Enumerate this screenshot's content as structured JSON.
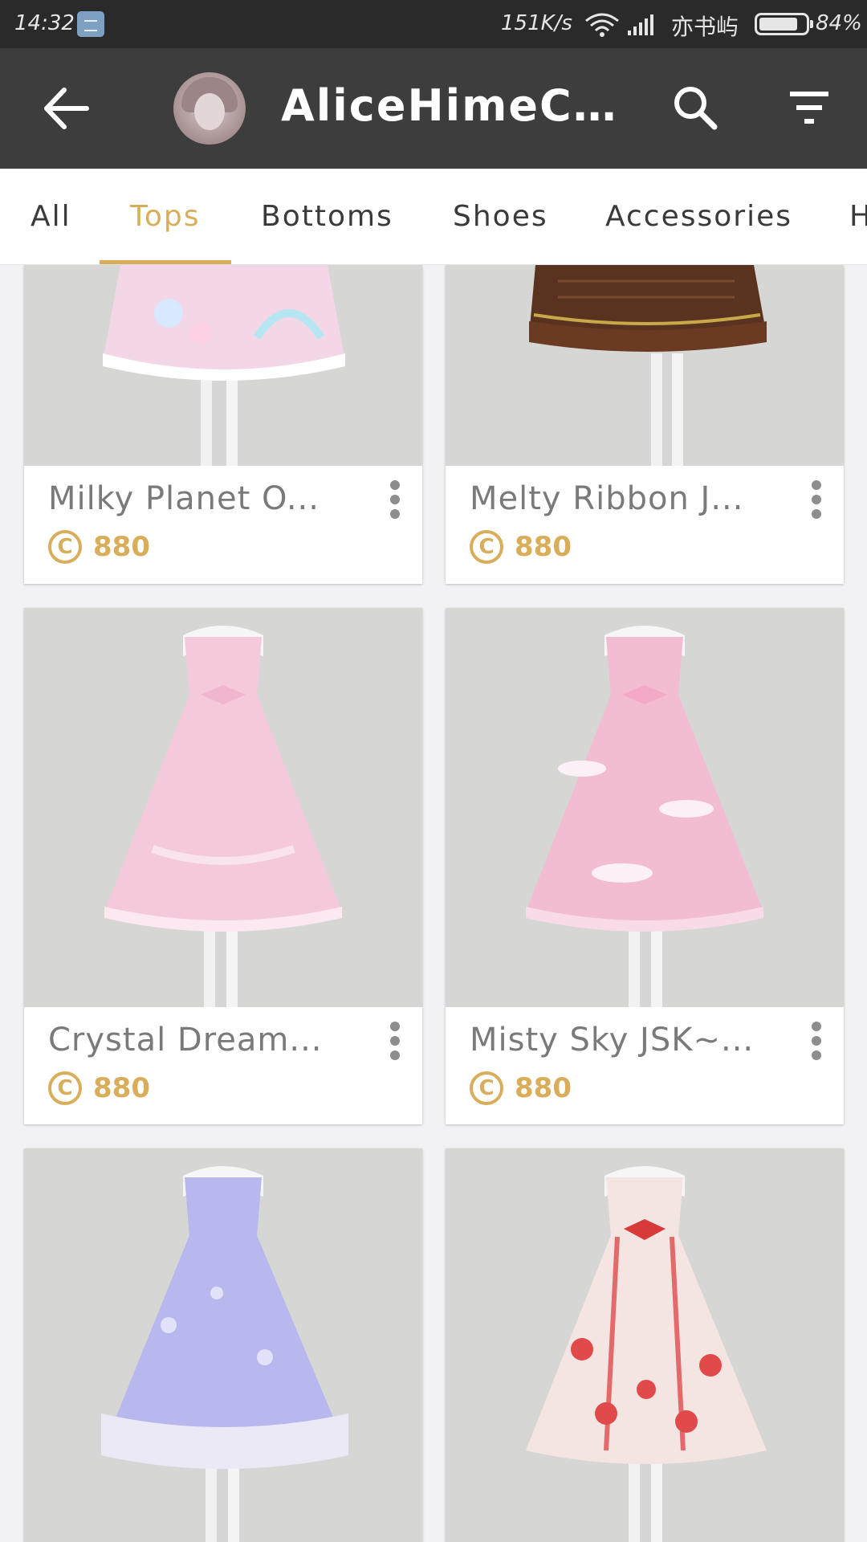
{
  "status_bar": {
    "time": "14:32",
    "net_speed": "151K/s",
    "carrier": "亦书屿",
    "battery_percent": "84%",
    "battery_level": 0.84
  },
  "app_bar": {
    "title": "AliceHimeCh...",
    "icons": {
      "back": "back-arrow-icon",
      "search": "search-icon",
      "filter": "filter-icon"
    }
  },
  "tabs": [
    {
      "label": "All"
    },
    {
      "label": "Tops",
      "active": true
    },
    {
      "label": "Bottoms"
    },
    {
      "label": "Shoes"
    },
    {
      "label": "Accessories"
    },
    {
      "label": "H"
    }
  ],
  "accent_color": "#d9ad5a",
  "items": [
    {
      "name": "Milky Planet O...",
      "price": "880",
      "dress_color": "#f3d7e6"
    },
    {
      "name": "Melty Ribbon J...",
      "price": "880",
      "dress_color": "#5a3320"
    },
    {
      "name": "Crystal Dream...",
      "price": "880",
      "dress_color": "#f4c9dc"
    },
    {
      "name": "Misty Sky JSK~...",
      "price": "880",
      "dress_color": "#f2bcd3"
    },
    {
      "name": "",
      "price": "",
      "dress_color": "#b8b8ee"
    },
    {
      "name": "",
      "price": "",
      "dress_color": "#f4e4e2"
    }
  ]
}
